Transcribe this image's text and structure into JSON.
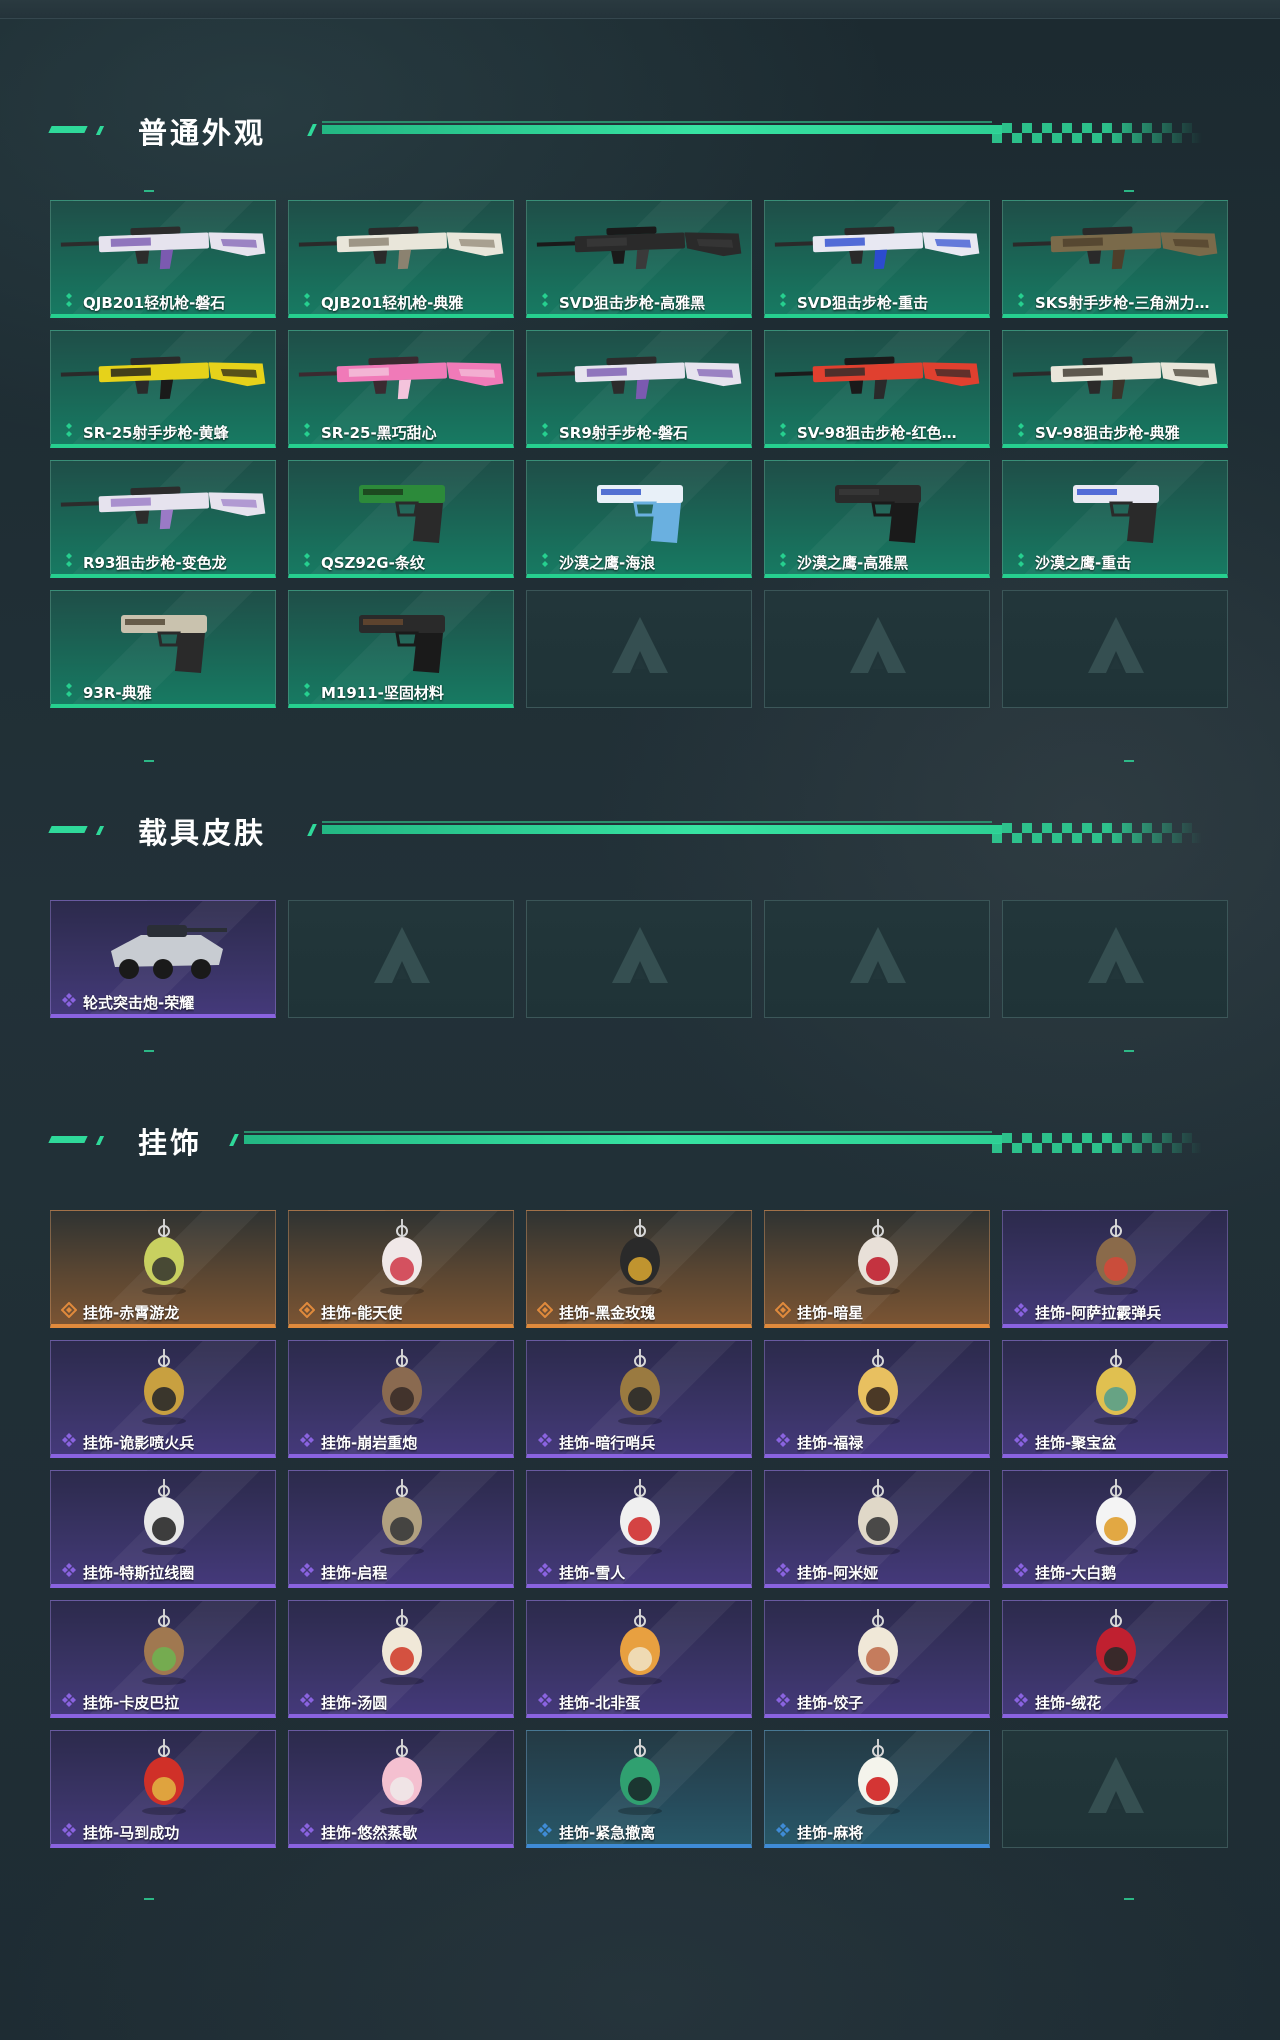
{
  "sections": [
    {
      "title": "普通外观",
      "items": [
        {
          "label": "QJB201轻机枪-磐石",
          "rarity": "green",
          "icon": "light-machine-gun-icon",
          "colors": [
            "#e6e3ee",
            "#7b5ab0",
            "#2c2c2c"
          ]
        },
        {
          "label": "QJB201轻机枪-典雅",
          "rarity": "green",
          "icon": "light-machine-gun-icon",
          "colors": [
            "#e9e6da",
            "#8b8270",
            "#2a2a2a"
          ]
        },
        {
          "label": "SVD狙击步枪-高雅黑",
          "rarity": "green",
          "icon": "sniper-rifle-icon",
          "colors": [
            "#2a2a2a",
            "#3a3a3a",
            "#1a1a1a"
          ]
        },
        {
          "label": "SVD狙击步枪-重击",
          "rarity": "green",
          "icon": "sniper-rifle-icon",
          "colors": [
            "#e8e8f2",
            "#2c4bd0",
            "#2a2a2a"
          ]
        },
        {
          "label": "SKS射手步枪-三角洲力…",
          "rarity": "green",
          "icon": "rifle-icon",
          "colors": [
            "#7a6a4a",
            "#4e3e2a",
            "#2a2a2a"
          ]
        },
        {
          "label": "SR-25射手步枪-黄蜂",
          "rarity": "green",
          "icon": "rifle-icon",
          "colors": [
            "#e6d21a",
            "#1a1a1a",
            "#2a2a2a"
          ]
        },
        {
          "label": "SR-25-黑巧甜心",
          "rarity": "green",
          "icon": "rifle-icon",
          "colors": [
            "#f07ab8",
            "#f4c4dc",
            "#3a2a30"
          ]
        },
        {
          "label": "SR9射手步枪-磐石",
          "rarity": "green",
          "icon": "rifle-icon",
          "colors": [
            "#e6e3ee",
            "#7b5ab0",
            "#2c2c2c"
          ]
        },
        {
          "label": "SV-98狙击步枪-红色…",
          "rarity": "green",
          "icon": "sniper-rifle-icon",
          "colors": [
            "#e0402f",
            "#2a2a2a",
            "#1a1a1a"
          ]
        },
        {
          "label": "SV-98狙击步枪-典雅",
          "rarity": "green",
          "icon": "sniper-rifle-icon",
          "colors": [
            "#e9e6da",
            "#3a342a",
            "#2a2a2a"
          ]
        },
        {
          "label": "R93狙击步枪-变色龙",
          "rarity": "green",
          "icon": "sniper-rifle-icon",
          "colors": [
            "#e6e3ee",
            "#9a7ac6",
            "#2c2c2c"
          ]
        },
        {
          "label": "QSZ92G-条纹",
          "rarity": "green",
          "icon": "pistol-icon",
          "colors": [
            "#2c8a3a",
            "#1a3a1a",
            "#2a2a2a"
          ]
        },
        {
          "label": "沙漠之鹰-海浪",
          "rarity": "green",
          "icon": "pistol-icon",
          "colors": [
            "#e8f0f8",
            "#2c50c8",
            "#6ab0e0"
          ]
        },
        {
          "label": "沙漠之鹰-高雅黑",
          "rarity": "green",
          "icon": "pistol-icon",
          "colors": [
            "#2a2a2a",
            "#3a3a3a",
            "#1a1a1a"
          ]
        },
        {
          "label": "沙漠之鹰-重击",
          "rarity": "green",
          "icon": "pistol-icon",
          "colors": [
            "#e8e8f2",
            "#2c4bd0",
            "#2a2a2a"
          ]
        },
        {
          "label": "93R-典雅",
          "rarity": "green",
          "icon": "pistol-icon",
          "colors": [
            "#c9c2ae",
            "#4e4230",
            "#2a2a2a"
          ]
        },
        {
          "label": "M1911-坚固材料",
          "rarity": "green",
          "icon": "pistol-icon",
          "colors": [
            "#2a2a2a",
            "#6a4a30",
            "#1a1a1a"
          ]
        },
        {
          "label": "",
          "rarity": "empty"
        },
        {
          "label": "",
          "rarity": "empty"
        },
        {
          "label": "",
          "rarity": "empty"
        }
      ]
    },
    {
      "title": "载具皮肤",
      "items": [
        {
          "label": "轮式突击炮-荣耀",
          "rarity": "purple",
          "icon": "vehicle-icon",
          "colors": [
            "#c8ccd2",
            "#2a2e36",
            "#1a1a1a"
          ]
        },
        {
          "label": "",
          "rarity": "empty"
        },
        {
          "label": "",
          "rarity": "empty"
        },
        {
          "label": "",
          "rarity": "empty"
        },
        {
          "label": "",
          "rarity": "empty"
        }
      ]
    },
    {
      "title": "挂饰",
      "items": [
        {
          "label": "挂饰-赤霄游龙",
          "rarity": "gold",
          "icon": "charm-icon",
          "colors": [
            "#c8d060",
            "#3a3a30"
          ]
        },
        {
          "label": "挂饰-能天使",
          "rarity": "gold",
          "icon": "charm-icon",
          "colors": [
            "#f0e8e8",
            "#d04050"
          ]
        },
        {
          "label": "挂饰-黑金玫瑰",
          "rarity": "gold",
          "icon": "charm-icon",
          "colors": [
            "#2a2a2a",
            "#d0a030"
          ]
        },
        {
          "label": "挂饰-暗星",
          "rarity": "gold",
          "icon": "charm-icon",
          "colors": [
            "#e8e0d8",
            "#c02030"
          ]
        },
        {
          "label": "挂饰-阿萨拉霰弹兵",
          "rarity": "purple",
          "icon": "charm-icon",
          "colors": [
            "#8a6a4a",
            "#d04a3a"
          ]
        },
        {
          "label": "挂饰-诡影喷火兵",
          "rarity": "purple",
          "icon": "charm-icon",
          "colors": [
            "#c8a040",
            "#2a2a2a"
          ]
        },
        {
          "label": "挂饰-崩岩重炮",
          "rarity": "purple",
          "icon": "charm-icon",
          "colors": [
            "#8a6a50",
            "#3a2e28"
          ]
        },
        {
          "label": "挂饰-暗行哨兵",
          "rarity": "purple",
          "icon": "charm-icon",
          "colors": [
            "#9a7a40",
            "#2a2a2a"
          ]
        },
        {
          "label": "挂饰-福禄",
          "rarity": "purple",
          "icon": "charm-icon",
          "colors": [
            "#e8c060",
            "#3a2a20"
          ]
        },
        {
          "label": "挂饰-聚宝盆",
          "rarity": "purple",
          "icon": "charm-icon",
          "colors": [
            "#e0c050",
            "#5aa08a"
          ]
        },
        {
          "label": "挂饰-特斯拉线圈",
          "rarity": "purple",
          "icon": "charm-icon",
          "colors": [
            "#e8e8e8",
            "#2a2a2a"
          ]
        },
        {
          "label": "挂饰-启程",
          "rarity": "purple",
          "icon": "charm-icon",
          "colors": [
            "#b0a080",
            "#3a3a3a"
          ]
        },
        {
          "label": "挂饰-雪人",
          "rarity": "purple",
          "icon": "charm-icon",
          "colors": [
            "#f0f0f0",
            "#d03030"
          ]
        },
        {
          "label": "挂饰-阿米娅",
          "rarity": "purple",
          "icon": "charm-icon",
          "colors": [
            "#e0d8c8",
            "#3a3a3a"
          ]
        },
        {
          "label": "挂饰-大白鹅",
          "rarity": "purple",
          "icon": "charm-icon",
          "colors": [
            "#f4f4f4",
            "#e0a030"
          ]
        },
        {
          "label": "挂饰-卡皮巴拉",
          "rarity": "purple",
          "icon": "charm-icon",
          "colors": [
            "#a07850",
            "#70b050"
          ]
        },
        {
          "label": "挂饰-汤圆",
          "rarity": "purple",
          "icon": "charm-icon",
          "colors": [
            "#f0e8d8",
            "#d04030"
          ]
        },
        {
          "label": "挂饰-北非蛋",
          "rarity": "purple",
          "icon": "charm-icon",
          "colors": [
            "#e8a040",
            "#f0e0c0"
          ]
        },
        {
          "label": "挂饰-饺子",
          "rarity": "purple",
          "icon": "charm-icon",
          "colors": [
            "#f0e8d8",
            "#c07050"
          ]
        },
        {
          "label": "挂饰-绒花",
          "rarity": "purple",
          "icon": "charm-icon",
          "colors": [
            "#c02030",
            "#2a2a2a"
          ]
        },
        {
          "label": "挂饰-马到成功",
          "rarity": "purple",
          "icon": "charm-icon",
          "colors": [
            "#d03028",
            "#e0b040"
          ]
        },
        {
          "label": "挂饰-悠然蒸歇",
          "rarity": "purple",
          "icon": "charm-icon",
          "colors": [
            "#f4c0d0",
            "#f0e8e8"
          ]
        },
        {
          "label": "挂饰-紧急撤离",
          "rarity": "blue",
          "icon": "charm-icon",
          "colors": [
            "#30a070",
            "#1a2a2a"
          ]
        },
        {
          "label": "挂饰-麻将",
          "rarity": "blue",
          "icon": "charm-icon",
          "colors": [
            "#f4f4ec",
            "#d02020"
          ]
        },
        {
          "label": "",
          "rarity": "empty"
        }
      ]
    }
  ],
  "colors": {
    "accent": "#2fd99a",
    "rarity_green": "#26d08f",
    "rarity_purple": "#8a63e0",
    "rarity_gold": "#e08a3c",
    "rarity_blue": "#3f8bd6"
  }
}
